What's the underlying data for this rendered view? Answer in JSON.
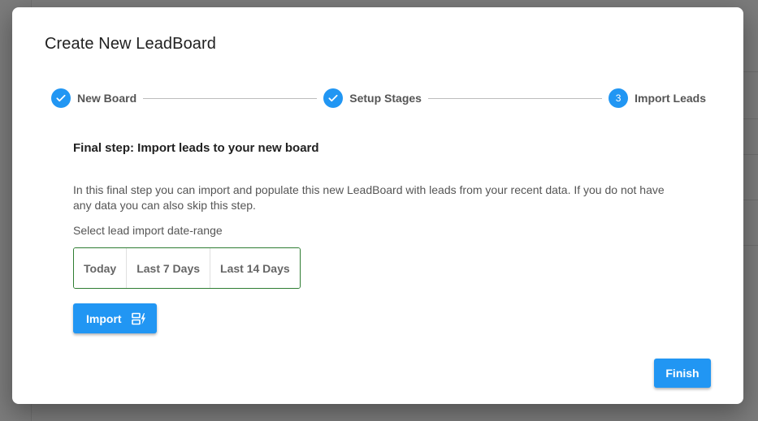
{
  "dialog": {
    "title": "Create New LeadBoard"
  },
  "stepper": {
    "steps": [
      {
        "label": "New Board",
        "status": "completed",
        "indicator": "check-icon"
      },
      {
        "label": "Setup Stages",
        "status": "completed",
        "indicator": "check-icon"
      },
      {
        "label": "Import Leads",
        "status": "active",
        "number": "3"
      }
    ]
  },
  "content": {
    "section_title": "Final step: Import leads to your new board",
    "description": "In this final step you can import and populate this new LeadBoard with leads from your recent data. If you do not have any data you can also skip this step.",
    "range_label": "Select lead import date-range",
    "range_options": [
      "Today",
      "Last 7 Days",
      "Last 14 Days"
    ],
    "import_label": "Import",
    "import_icon": "import-leads-icon"
  },
  "footer": {
    "finish_label": "Finish"
  },
  "colors": {
    "primary": "#2196f3",
    "range_border": "#2e7d32",
    "backdrop": "#7b7b7b"
  }
}
